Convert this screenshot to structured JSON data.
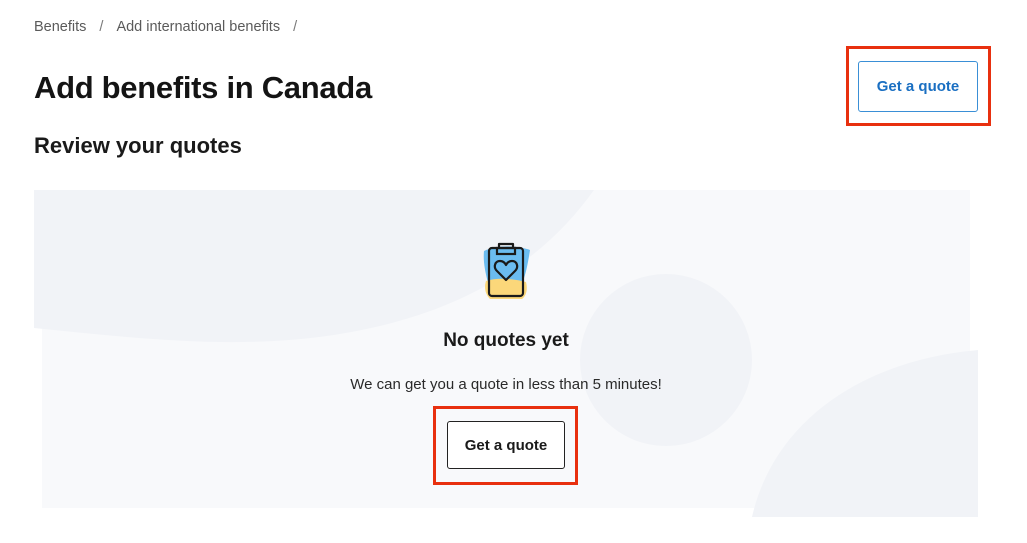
{
  "breadcrumb": {
    "items": [
      "Benefits",
      "Add international benefits"
    ],
    "separator": "/"
  },
  "page_title": "Add benefits in Canada",
  "header_action": {
    "label": "Get a quote"
  },
  "section_title": "Review your quotes",
  "empty_state": {
    "icon": "clipboard-heart-icon",
    "heading": "No quotes yet",
    "description": "We can get you a quote in less than 5 minutes!",
    "button_label": "Get a quote"
  },
  "colors": {
    "accent": "#1a6fc2",
    "highlight": "#e8300f",
    "panel_shape": "#f4f6fa",
    "icon_blue": "#6bbcf0",
    "icon_yellow": "#fbd77a"
  }
}
